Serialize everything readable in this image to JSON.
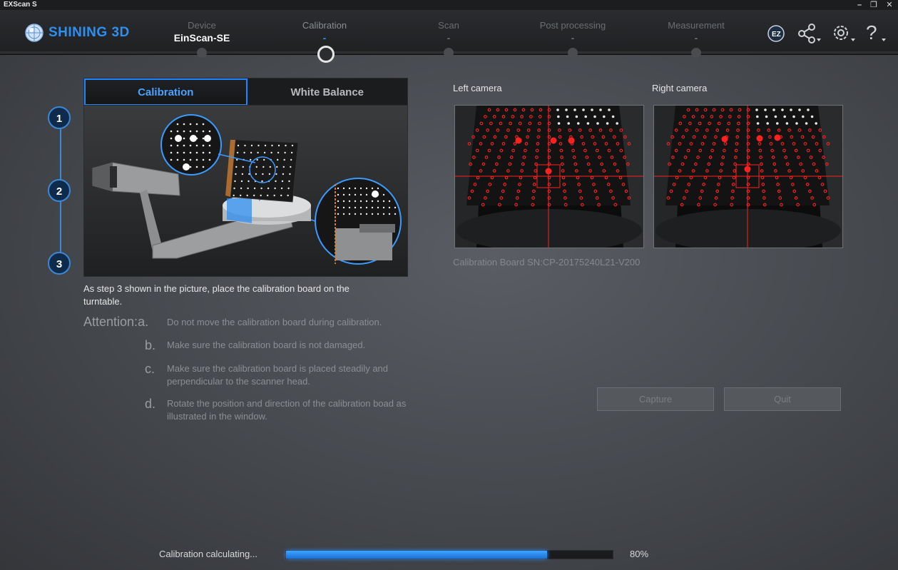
{
  "window": {
    "title": "EXScan S"
  },
  "brand": {
    "name": "SHINING 3D",
    "color": "#2f8ff0"
  },
  "workflow": {
    "steps": [
      {
        "label": "Device",
        "value": "EinScan-SE"
      },
      {
        "label": "Calibration",
        "value": "-"
      },
      {
        "label": "Scan",
        "value": "-"
      },
      {
        "label": "Post processing",
        "value": "-"
      },
      {
        "label": "Measurement",
        "value": "-"
      }
    ]
  },
  "header_icons": [
    "ez-logo-icon",
    "share-icon",
    "gear-icon",
    "help-icon"
  ],
  "tabs": {
    "calibration": "Calibration",
    "white_balance": "White Balance"
  },
  "step_numbers": [
    "1",
    "2",
    "3"
  ],
  "instruction": "As step 3 shown in the picture, place the calibration board on the turntable.",
  "attention": {
    "heading": "Attention:",
    "items": [
      {
        "letter": "a.",
        "text": "Do not move the calibration board during calibration."
      },
      {
        "letter": "b.",
        "text": "Make sure the calibration board is not damaged."
      },
      {
        "letter": "c.",
        "text": "Make sure the calibration board is placed steadily and perpendicular to the scanner head."
      },
      {
        "letter": "d.",
        "text": "Rotate the position and direction of the calibration boad as illustrated in the window."
      }
    ]
  },
  "cameras": {
    "left_label": "Left camera",
    "right_label": "Right camera"
  },
  "serial": "Calibration Board SN:CP-20175240L21-V200",
  "buttons": {
    "capture": "Capture",
    "quit": "Quit"
  },
  "progress": {
    "label": "Calibration calculating...",
    "value": 0.8,
    "percent_text": "80%"
  },
  "colors": {
    "accent": "#1f86ff",
    "target": "#ff2020"
  }
}
